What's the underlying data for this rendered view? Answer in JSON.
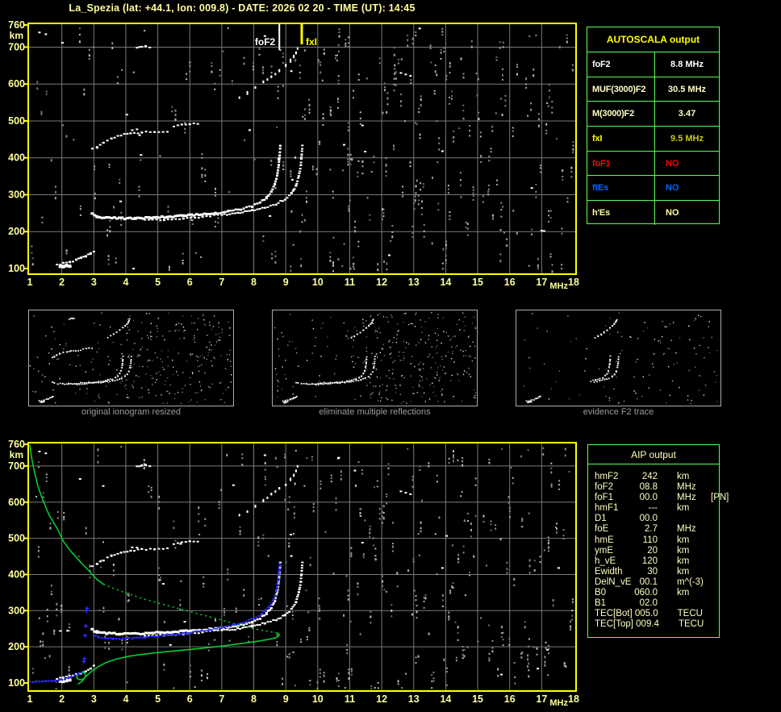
{
  "title": "La_Spezia (lat: +44.1, lon: 009.8) - DATE: 2026 02 20 - TIME (UT): 14:45",
  "colors": {
    "background": "#000000",
    "frame_yellow": "#FFFF00",
    "axis_label_yellow": "#FFFF9C",
    "grid_gray": "#7A7A7A",
    "table_border_green": "#5CFF5C",
    "trace_white": "#FFFFFF",
    "profile_green": "#00CC33",
    "autoscaled_trace_blue": "#2B2BFF",
    "status_red": "#FF0000",
    "status_blue": "#0066FF",
    "caption_gray": "#9A9A9A"
  },
  "autoscala": {
    "title": "AUTOSCALA output",
    "rows": [
      {
        "label": "foF2",
        "value": "8.8 MHz",
        "label_color": "#FFFFFF",
        "value_color": "#FFFFFF",
        "align": "center"
      },
      {
        "label": "MUF(3000)F2",
        "value": "30.5 MHz",
        "label_color": "#FFFFC6",
        "value_color": "#FFFFC6",
        "align": "center"
      },
      {
        "label": "M(3000)F2",
        "value": "3.47",
        "label_color": "#FFFFC6",
        "value_color": "#FFFFC6",
        "align": "center"
      },
      {
        "label": "fxI",
        "value": "9.5 MHz",
        "label_color": "#FFFF00",
        "value_color": "#C9C915",
        "align": "center"
      },
      {
        "label": "foF1",
        "value": "NO",
        "label_color": "#FF0000",
        "value_color": "#FF0000",
        "align": "left"
      },
      {
        "label": "ftEs",
        "value": "NO",
        "label_color": "#0066FF",
        "value_color": "#0066FF",
        "align": "left"
      },
      {
        "label": "h'Es",
        "value": "NO",
        "label_color": "#FFFF9C",
        "value_color": "#FFFF9C",
        "align": "left"
      }
    ]
  },
  "thumbnails": [
    {
      "caption": "original ionogram resized"
    },
    {
      "caption": "eliminate multiple reflections"
    },
    {
      "caption": "evidence F2 trace"
    }
  ],
  "aip": {
    "title": "AIP output",
    "rows": [
      {
        "label": "hmF2",
        "value": "242",
        "unit": "km",
        "extra": ""
      },
      {
        "label": "foF2",
        "value": "08.8",
        "unit": "MHz",
        "extra": ""
      },
      {
        "label": "foF1",
        "value": "00.0",
        "unit": "MHz",
        "extra": "[PN]"
      },
      {
        "label": "hmF1",
        "value": "---",
        "unit": "km",
        "extra": ""
      },
      {
        "label": "D1",
        "value": "00.0",
        "unit": "",
        "extra": ""
      },
      {
        "label": "foE",
        "value": "2.7",
        "unit": "MHz",
        "extra": ""
      },
      {
        "label": "hmE",
        "value": "110",
        "unit": "km",
        "extra": ""
      },
      {
        "label": "ymE",
        "value": "20",
        "unit": "km",
        "extra": ""
      },
      {
        "label": "h_vE",
        "value": "120",
        "unit": "km",
        "extra": ""
      },
      {
        "label": "Ewidth",
        "value": "30",
        "unit": "km",
        "extra": ""
      },
      {
        "label": "DelN_vE",
        "value": "00.1",
        "unit": "m^(-3)",
        "extra": ""
      },
      {
        "label": "B0",
        "value": "060.0",
        "unit": "km",
        "extra": ""
      },
      {
        "label": "B1",
        "value": "02.0",
        "unit": "",
        "extra": ""
      },
      {
        "label": "TEC[Bot]",
        "value": "005.0",
        "unit": "TECU",
        "extra": ""
      },
      {
        "label": "TEC[Top]",
        "value": "009.4",
        "unit": "TECU",
        "extra": ""
      }
    ]
  },
  "chart_data": [
    {
      "id": "top_ionogram",
      "type": "scatter",
      "title": "ionogram with autoscaled characteristics",
      "xlabel": "MHz",
      "ylabel": "km",
      "xlim": [
        1,
        18
      ],
      "ylim": [
        85,
        760
      ],
      "grid": true,
      "x_ticks": [
        "1",
        "2",
        "3",
        "4",
        "5",
        "6",
        "7",
        "8",
        "9",
        "10",
        "11",
        "12",
        "13",
        "14",
        "15",
        "16",
        "17",
        "18"
      ],
      "y_ticks": [
        "760",
        "700",
        "600",
        "500",
        "400",
        "300",
        "200",
        "100"
      ],
      "markers": [
        {
          "name": "foF2",
          "label": "foF2",
          "value_mhz": 8.8,
          "color": "#FFFFFF",
          "side": "left"
        },
        {
          "name": "fxI",
          "label": "fxI",
          "value_mhz": 9.5,
          "color": "#FFFF00",
          "side": "right"
        }
      ],
      "traces": {
        "E_blob": [
          [
            1.95,
            104
          ],
          [
            2.05,
            106
          ],
          [
            2.15,
            108
          ],
          [
            2.25,
            107
          ]
        ],
        "E_trace": [
          [
            1.85,
            111
          ],
          [
            2.05,
            114
          ],
          [
            2.25,
            118
          ],
          [
            2.45,
            123
          ],
          [
            2.6,
            128
          ],
          [
            2.75,
            133
          ],
          [
            2.9,
            140
          ],
          [
            3.0,
            146
          ]
        ],
        "F_flat": [
          [
            2.95,
            247
          ],
          [
            3.1,
            241
          ],
          [
            3.4,
            237
          ],
          [
            3.8,
            236
          ],
          [
            4.3,
            236
          ],
          [
            4.8,
            238
          ],
          [
            5.3,
            240
          ],
          [
            5.8,
            243
          ],
          [
            6.3,
            246
          ],
          [
            6.8,
            250
          ]
        ],
        "o_branch": [
          [
            6.8,
            250
          ],
          [
            7.2,
            255
          ],
          [
            7.6,
            261
          ],
          [
            7.95,
            269
          ],
          [
            8.2,
            279
          ],
          [
            8.4,
            292
          ],
          [
            8.55,
            308
          ],
          [
            8.66,
            328
          ],
          [
            8.73,
            352
          ],
          [
            8.78,
            380
          ],
          [
            8.81,
            408
          ],
          [
            8.83,
            432
          ]
        ],
        "x_flat": [
          [
            4.6,
            231
          ],
          [
            5.2,
            233
          ],
          [
            5.8,
            236
          ],
          [
            6.4,
            240
          ],
          [
            7.0,
            245
          ]
        ],
        "x_branch": [
          [
            7.0,
            245
          ],
          [
            7.5,
            250
          ],
          [
            7.95,
            257
          ],
          [
            8.35,
            265
          ],
          [
            8.7,
            275
          ],
          [
            8.98,
            288
          ],
          [
            9.18,
            304
          ],
          [
            9.32,
            324
          ],
          [
            9.41,
            350
          ],
          [
            9.47,
            380
          ],
          [
            9.5,
            410
          ],
          [
            9.52,
            432
          ]
        ],
        "hop2_a": [
          [
            2.95,
            424
          ],
          [
            3.1,
            429
          ],
          [
            3.3,
            440
          ],
          [
            3.55,
            452
          ],
          [
            3.85,
            461
          ],
          [
            4.15,
            466
          ],
          [
            4.5,
            469
          ],
          [
            4.9,
            470
          ],
          [
            5.3,
            472
          ]
        ],
        "hop2_b": [
          [
            5.5,
            486
          ],
          [
            5.75,
            489
          ],
          [
            6.0,
            491
          ],
          [
            6.25,
            493
          ]
        ],
        "hop2_c": [
          [
            4.2,
            474
          ],
          [
            4.35,
            476
          ]
        ],
        "arc2": [
          [
            7.55,
            562
          ],
          [
            7.8,
            576
          ],
          [
            8.05,
            590
          ],
          [
            8.3,
            604
          ],
          [
            8.55,
            620
          ],
          [
            8.8,
            636
          ],
          [
            9.0,
            650
          ],
          [
            9.15,
            663
          ],
          [
            9.25,
            675
          ],
          [
            9.32,
            686
          ],
          [
            9.37,
            697
          ]
        ],
        "dash700": [
          [
            4.35,
            699
          ],
          [
            4.5,
            701
          ],
          [
            4.62,
            702
          ],
          [
            4.75,
            700
          ]
        ],
        "specks": [
          [
            12.6,
            630
          ],
          [
            12.75,
            626
          ],
          [
            12.9,
            622
          ],
          [
            1.3,
            740
          ],
          [
            1.5,
            735
          ],
          [
            11.4,
            488
          ],
          [
            13.9,
            418
          ],
          [
            8.35,
            730
          ]
        ]
      }
    },
    {
      "id": "bottom_ionogram",
      "type": "scatter",
      "title": "ionogram with restored trace and electron density profile",
      "xlabel": "MHz",
      "ylabel": "km",
      "xlim": [
        1,
        18
      ],
      "ylim": [
        85,
        760
      ],
      "grid": true,
      "x_ticks": [
        "1",
        "2",
        "3",
        "4",
        "5",
        "6",
        "7",
        "8",
        "9",
        "10",
        "11",
        "12",
        "13",
        "14",
        "15",
        "16",
        "17",
        "18"
      ],
      "y_ticks": [
        "760",
        "700",
        "600",
        "500",
        "400",
        "300",
        "200",
        "100"
      ],
      "white_traces_ref": "top_ionogram",
      "green_profile": {
        "upper_solid": [
          [
            1.0,
            758
          ],
          [
            1.06,
            720
          ],
          [
            1.14,
            685
          ],
          [
            1.25,
            645
          ],
          [
            1.4,
            607
          ],
          [
            1.6,
            565
          ],
          [
            1.85,
            528
          ],
          [
            2.06,
            490
          ],
          [
            2.3,
            462
          ],
          [
            2.58,
            435
          ],
          [
            2.85,
            410
          ],
          [
            3.09,
            387
          ],
          [
            3.3,
            373
          ]
        ],
        "upper_dotted": [
          [
            3.3,
            373
          ],
          [
            3.6,
            362
          ],
          [
            4.0,
            349
          ],
          [
            4.5,
            334
          ],
          [
            5.1,
            319
          ],
          [
            5.7,
            305
          ],
          [
            6.4,
            288
          ],
          [
            7.0,
            274
          ],
          [
            7.6,
            258
          ],
          [
            8.1,
            248
          ],
          [
            8.5,
            242
          ],
          [
            8.7,
            239
          ]
        ],
        "nose_and_lower_solid": [
          [
            8.7,
            239
          ],
          [
            8.78,
            236
          ],
          [
            8.8,
            232
          ],
          [
            8.72,
            226
          ],
          [
            8.5,
            221
          ],
          [
            8.1,
            215
          ],
          [
            7.6,
            209
          ],
          [
            7.0,
            202
          ],
          [
            6.4,
            196
          ],
          [
            5.8,
            191
          ],
          [
            5.2,
            186
          ],
          [
            4.6,
            180
          ],
          [
            4.1,
            174
          ],
          [
            3.7,
            166
          ],
          [
            3.4,
            157
          ],
          [
            3.15,
            146
          ],
          [
            2.98,
            136
          ],
          [
            2.86,
            127
          ],
          [
            2.76,
            119
          ],
          [
            2.7,
            113
          ]
        ],
        "E_layer_loop": [
          [
            2.7,
            113
          ],
          [
            2.62,
            109
          ],
          [
            2.52,
            110
          ],
          [
            2.46,
            115
          ],
          [
            2.49,
            122
          ],
          [
            2.57,
            128
          ],
          [
            2.66,
            130
          ],
          [
            2.72,
            127
          ],
          [
            2.74,
            120
          ],
          [
            2.7,
            112
          ],
          [
            2.64,
            105
          ],
          [
            2.56,
            100
          ],
          [
            2.5,
            97
          ]
        ]
      },
      "blue_trace": {
        "E_flat": [
          [
            1.0,
            103
          ],
          [
            1.1,
            103
          ],
          [
            1.2,
            104
          ],
          [
            1.3,
            104
          ],
          [
            1.4,
            104
          ],
          [
            1.5,
            105
          ],
          [
            1.6,
            105
          ],
          [
            1.7,
            105
          ],
          [
            1.8,
            106
          ],
          [
            1.9,
            106
          ],
          [
            2.0,
            108
          ],
          [
            2.1,
            111
          ],
          [
            2.2,
            114
          ],
          [
            2.3,
            117
          ],
          [
            2.4,
            121
          ],
          [
            2.5,
            125
          ],
          [
            2.6,
            129
          ]
        ],
        "isolated": [
          [
            2.68,
            160
          ],
          [
            2.7,
            168
          ],
          [
            2.72,
            232
          ],
          [
            2.74,
            258
          ],
          [
            2.76,
            300
          ],
          [
            2.78,
            307
          ]
        ],
        "F_trace": [
          [
            3.0,
            231
          ],
          [
            3.15,
            227
          ],
          [
            3.35,
            224
          ],
          [
            3.6,
            223
          ],
          [
            3.9,
            223
          ],
          [
            4.2,
            224
          ],
          [
            4.6,
            226
          ],
          [
            5.0,
            229
          ],
          [
            5.4,
            233
          ],
          [
            5.8,
            237
          ],
          [
            6.2,
            242
          ],
          [
            6.6,
            247
          ],
          [
            7.0,
            253
          ],
          [
            7.35,
            260
          ],
          [
            7.7,
            268
          ],
          [
            8.0,
            278
          ],
          [
            8.25,
            291
          ],
          [
            8.45,
            307
          ],
          [
            8.6,
            327
          ],
          [
            8.7,
            352
          ],
          [
            8.76,
            382
          ],
          [
            8.8,
            410
          ],
          [
            8.82,
            430
          ]
        ]
      }
    }
  ]
}
